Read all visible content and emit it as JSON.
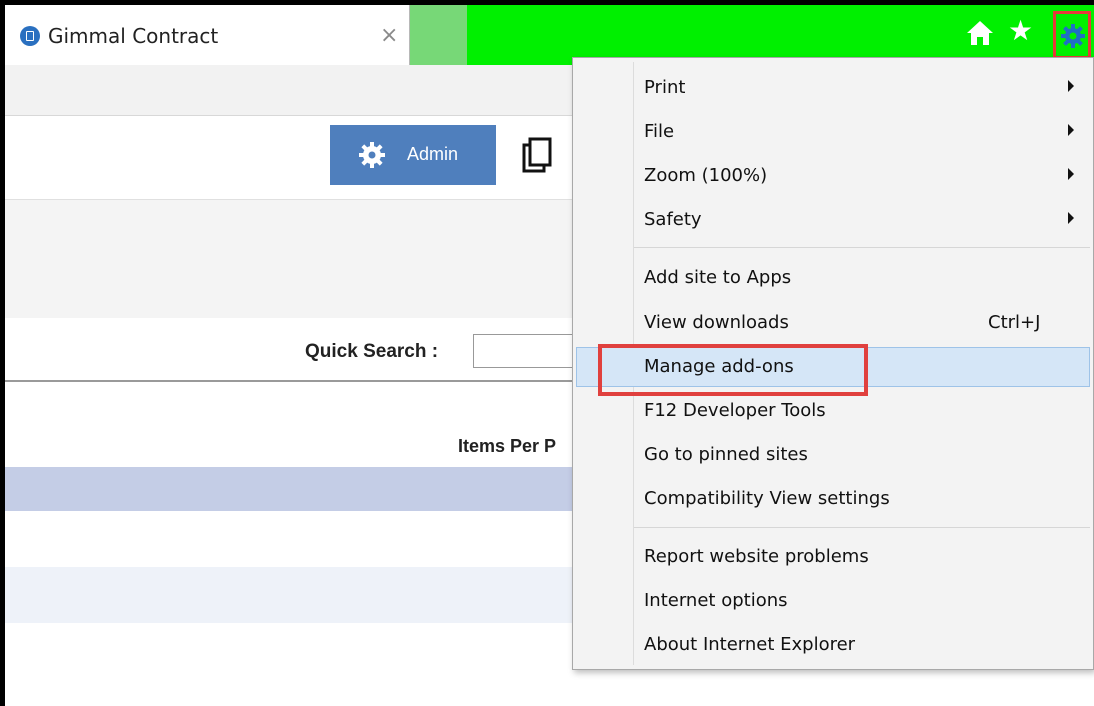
{
  "tab": {
    "title": "Gimmal Contract",
    "close_glyph": "×",
    "favicon": "site-icon"
  },
  "toolbar": {
    "home_icon": "home-icon",
    "favorites_icon": "star-icon",
    "tools_icon": "gear-icon",
    "star_glyph": "★"
  },
  "page": {
    "admin_label": "Admin",
    "quick_search_label": "Quick Search :",
    "quick_search_value": "",
    "items_per_page_label": "Items Per P"
  },
  "menu": {
    "group1": [
      {
        "label": "Print",
        "submenu": true
      },
      {
        "label": "File",
        "submenu": true
      },
      {
        "label": "Zoom (100%)",
        "submenu": true
      },
      {
        "label": "Safety",
        "submenu": true
      }
    ],
    "group2": [
      {
        "label": "Add site to Apps"
      },
      {
        "label": "View downloads",
        "shortcut": "Ctrl+J"
      },
      {
        "label": "Manage add-ons",
        "highlighted": true
      },
      {
        "label": "F12 Developer Tools"
      },
      {
        "label": "Go to pinned sites"
      },
      {
        "label": "Compatibility View settings"
      }
    ],
    "group3": [
      {
        "label": "Report website problems"
      },
      {
        "label": "Internet options"
      },
      {
        "label": "About Internet Explorer"
      }
    ]
  },
  "colors": {
    "tabbar_bg": "#00f000",
    "admin_btn": "#4f7fbd",
    "highlight_outline": "#e0403e",
    "menu_hover": "#d5e6f7",
    "row_blue": "#c4cde6"
  }
}
